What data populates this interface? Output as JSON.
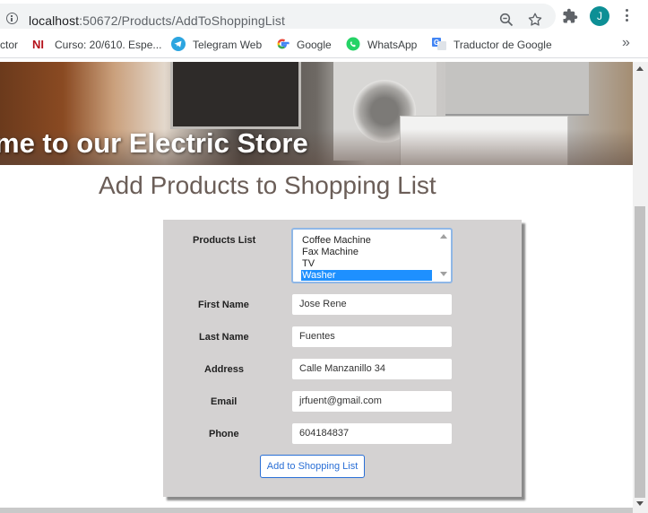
{
  "browser": {
    "url_host": "localhost",
    "url_path": ":50672/Products/AddToShoppingList",
    "avatar_letter": "J",
    "accent": "#0d8f95"
  },
  "bookmarks": [
    {
      "label": "ctor",
      "icon": ""
    },
    {
      "label": "Curso: 20/610. Espe...",
      "icon": "ni-icon"
    },
    {
      "label": "Telegram Web",
      "icon": "telegram-icon"
    },
    {
      "label": "Google",
      "icon": "google-icon"
    },
    {
      "label": "WhatsApp",
      "icon": "whatsapp-icon"
    },
    {
      "label": "Traductor de Google",
      "icon": "translate-icon"
    }
  ],
  "banner": {
    "text": "me to our Electric Store"
  },
  "page_title": "Add Products to Shopping List",
  "form": {
    "products_label": "Products List",
    "products": [
      "Coffee Machine",
      "Fax Machine",
      "TV",
      "Washer"
    ],
    "selected_product": "Washer",
    "first_name_label": "First Name",
    "first_name": "Jose Rene",
    "last_name_label": "Last Name",
    "last_name": "Fuentes",
    "address_label": "Address",
    "address": "Calle Manzanillo 34",
    "email_label": "Email",
    "email": "jrfuent@gmail.com",
    "phone_label": "Phone",
    "phone": "604184837",
    "submit_label": "Add to Shopping List"
  }
}
